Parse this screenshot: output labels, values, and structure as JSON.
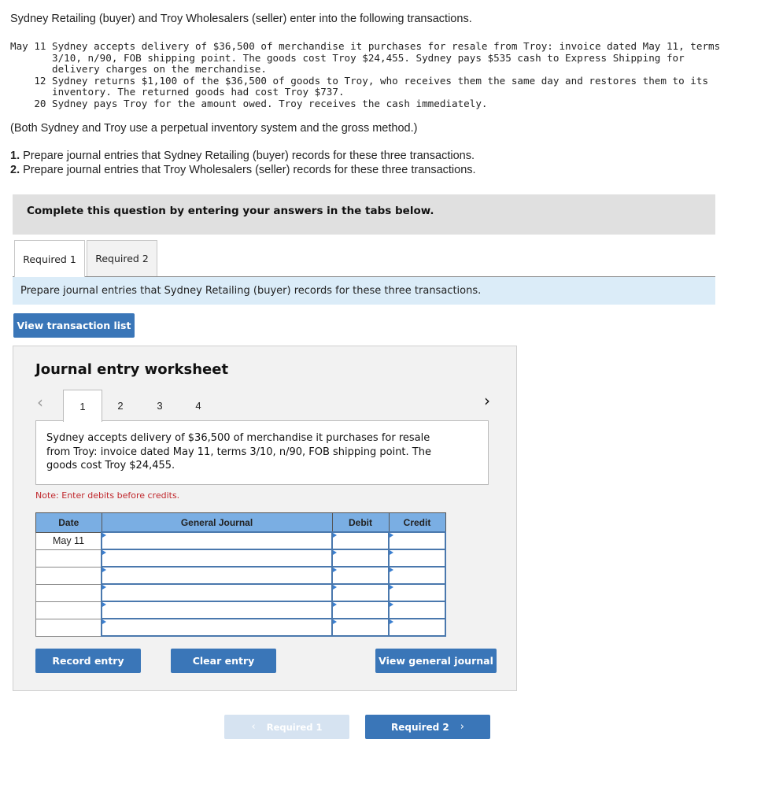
{
  "problem": {
    "intro": "Sydney Retailing (buyer) and Troy Wholesalers (seller) enter into the following transactions.",
    "transactions": [
      {
        "date": "May 11",
        "text": "Sydney accepts delivery of $36,500 of merchandise it purchases for resale from Troy: invoice dated May 11, terms 3/10, n/90, FOB shipping point. The goods cost Troy $24,455. Sydney pays $535 cash to Express Shipping for delivery charges on the merchandise."
      },
      {
        "date": "    12",
        "text": "Sydney returns $1,100 of the $36,500 of goods to Troy, who receives them the same day and restores them to its inventory. The returned goods had cost Troy $737."
      },
      {
        "date": "    20",
        "text": "Sydney pays Troy for the amount owed. Troy receives the cash immediately."
      }
    ],
    "note": "(Both Sydney and Troy use a perpetual inventory system and the gross method.)",
    "requirements": [
      {
        "num": "1.",
        "text": " Prepare journal entries that Sydney Retailing (buyer) records for these three transactions."
      },
      {
        "num": "2.",
        "text": " Prepare journal entries that Troy Wholesalers (seller) records for these three transactions."
      }
    ]
  },
  "banner": "Complete this question by entering your answers in the tabs below.",
  "tabs": [
    {
      "label": "Required 1",
      "active": true
    },
    {
      "label": "Required 2",
      "active": false
    }
  ],
  "instruction": "Prepare journal entries that Sydney Retailing (buyer) records for these three transactions.",
  "view_transaction_list": "View transaction list",
  "worksheet": {
    "title": "Journal entry worksheet",
    "prev_icon": "‹",
    "next_icon": "›",
    "entry_tabs": [
      "1",
      "2",
      "3",
      "4"
    ],
    "active_entry": "1",
    "description": "Sydney accepts delivery of $36,500 of merchandise it purchases for resale from Troy: invoice dated May 11, terms 3/10, n/90, FOB shipping point. The goods cost Troy $24,455.",
    "note": "Note: Enter debits before credits.",
    "table": {
      "headers": [
        "Date",
        "General Journal",
        "Debit",
        "Credit"
      ],
      "rows": [
        {
          "date": "May 11",
          "account": "",
          "debit": "",
          "credit": ""
        },
        {
          "date": "",
          "account": "",
          "debit": "",
          "credit": ""
        },
        {
          "date": "",
          "account": "",
          "debit": "",
          "credit": ""
        },
        {
          "date": "",
          "account": "",
          "debit": "",
          "credit": ""
        },
        {
          "date": "",
          "account": "",
          "debit": "",
          "credit": ""
        },
        {
          "date": "",
          "account": "",
          "debit": "",
          "credit": ""
        }
      ]
    },
    "buttons": {
      "record": "Record entry",
      "clear": "Clear entry",
      "view_general_journal": "View general journal"
    }
  },
  "nav": {
    "prev_label": "Required 1",
    "next_label": "Required 2",
    "prev_icon": "‹",
    "next_icon": "›"
  },
  "colors": {
    "primary_button": "#3a76b8",
    "disabled_button": "#d6e3f1",
    "table_header": "#7aaee3",
    "note_red": "#c0282d",
    "instruction_bg": "#dbecf8"
  }
}
